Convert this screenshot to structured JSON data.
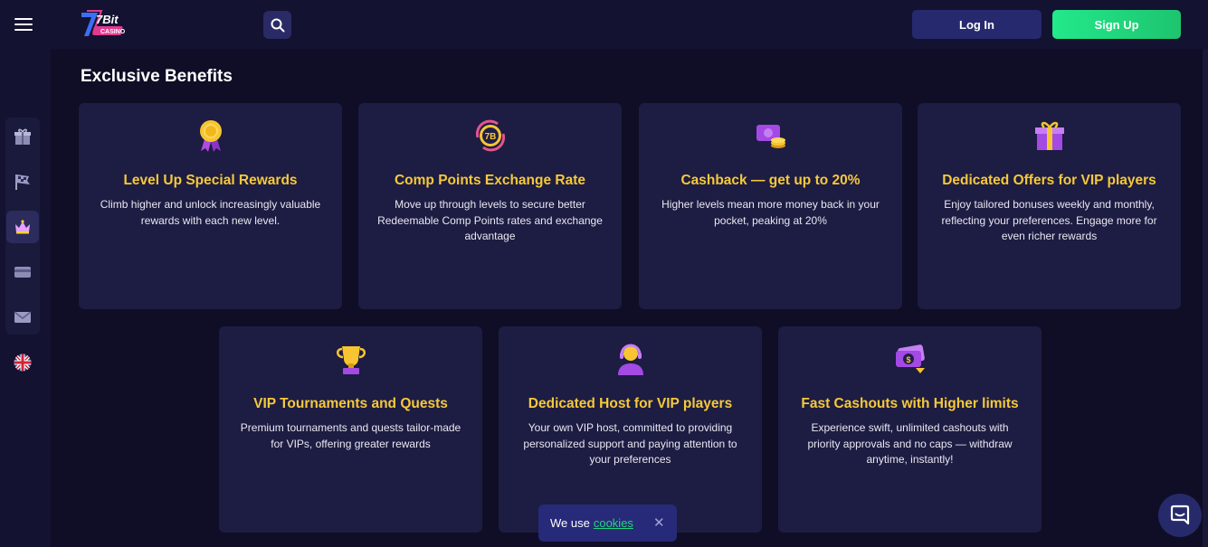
{
  "header": {
    "login_label": "Log In",
    "signup_label": "Sign Up",
    "logo_text": "7Bit",
    "logo_subtext": "CASINO"
  },
  "sidebar": {
    "items": [
      {
        "icon": "gift-icon"
      },
      {
        "icon": "checkered-flag-icon"
      },
      {
        "icon": "crown-icon",
        "active": true
      },
      {
        "icon": "card-icon"
      },
      {
        "icon": "mail-icon"
      },
      {
        "icon": "uk-flag-icon"
      }
    ]
  },
  "main": {
    "section_title": "Exclusive Benefits",
    "cards": [
      {
        "icon": "medal-icon",
        "title": "Level Up Special Rewards",
        "desc": "Climb higher and unlock increasingly valuable rewards with each new level."
      },
      {
        "icon": "comp-points-coin-icon",
        "title": "Comp Points Exchange Rate",
        "desc": "Move up through levels to secure better Redeemable Comp Points rates and exchange advantage"
      },
      {
        "icon": "cashback-icon",
        "title": "Cashback — get up to 20%",
        "desc": "Higher levels mean more money back in your pocket, peaking at 20%"
      },
      {
        "icon": "gift-box-icon",
        "title": "Dedicated Offers for VIP players",
        "desc": "Enjoy tailored bonuses weekly and monthly, reflecting your preferences. Engage more for even richer rewards"
      },
      {
        "icon": "trophy-icon",
        "title": "VIP Tournaments and Quests",
        "desc": "Premium tournaments and quests tailor-made for VIPs, offering greater rewards"
      },
      {
        "icon": "host-headset-icon",
        "title": "Dedicated Host for VIP players",
        "desc": "Your own VIP host, committed to providing personalized support and paying attention to your preferences"
      },
      {
        "icon": "fast-cashout-icon",
        "title": "Fast Cashouts with Higher limits",
        "desc": "Experience swift, unlimited cashouts with priority approvals and no caps — withdraw anytime, instantly!"
      }
    ]
  },
  "cookie_banner": {
    "text": "We use",
    "link": "cookies",
    "close": "✕"
  },
  "colors": {
    "background": "#0f0e26",
    "card": "#1d1c42",
    "accent_title": "#f5c93a",
    "signup_green": "#22e98a",
    "login_blue": "#27296e"
  }
}
